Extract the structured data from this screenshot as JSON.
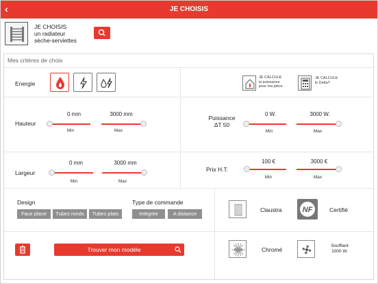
{
  "header": {
    "back_icon": "chevron-left-icon",
    "title": "JE CHOISIS"
  },
  "choose": {
    "line1": "JE CHOISIS",
    "line2": "un radiateur",
    "line3": "sèche-serviettes",
    "icon": "radiator-icon"
  },
  "criteria_title": "Mes critères de choix",
  "energie": {
    "label": "Energie",
    "options": [
      "drop-icon",
      "lightning-icon",
      "drop-lightning-icon"
    ],
    "active_index": 0
  },
  "calc": {
    "power_l1": "JE CALCULE",
    "power_l2": "la puissance",
    "power_l3": "pour ma pièce",
    "delta_l1": "JE CALCULE",
    "delta_l2": "le DeltaT"
  },
  "hauteur": {
    "label": "Hauteur",
    "min_val": "0 mm",
    "max_val": "3000 mm",
    "min_label": "Min",
    "max_label": "Max"
  },
  "puissance": {
    "label_l1": "Puissance",
    "label_l2": "ΔT 50",
    "min_val": "0 W.",
    "max_val": "3000 W.",
    "min_label": "Min",
    "max_label": "Max"
  },
  "largeur": {
    "label": "Largeur",
    "min_val": "0 mm",
    "max_val": "3000 mm",
    "min_label": "Min",
    "max_label": "Max"
  },
  "prix": {
    "label": "Prix H.T.",
    "min_val": "100 €",
    "max_val": "3000 €",
    "min_label": "Min",
    "max_label": "Max"
  },
  "design": {
    "label": "Design",
    "tags": [
      "Face plane",
      "Tubes ronds",
      "Tubes plats"
    ]
  },
  "commande": {
    "label": "Type de commande",
    "tags": [
      "Intégrée",
      "A distance"
    ]
  },
  "features": {
    "claustra": "Claustra",
    "certifie": "Certifié",
    "nf_badge": "NF",
    "chrome": "Chromé",
    "soufflant_l1": "Soufflant",
    "soufflant_l2": "1000 W."
  },
  "actions": {
    "find_label": "Trouver mon modèle",
    "trash_icon": "trash-icon",
    "search_icon": "search-icon"
  },
  "colors": {
    "accent": "#e8392f",
    "tag_grey": "#8f8f8f"
  }
}
